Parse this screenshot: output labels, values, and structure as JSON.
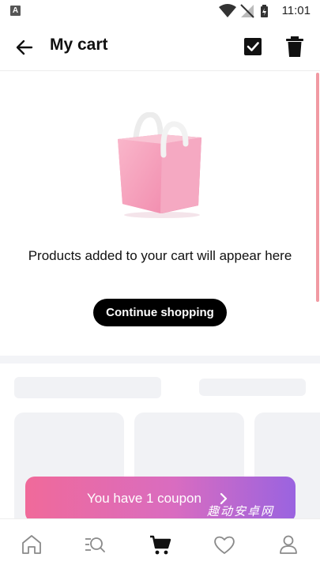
{
  "status_bar": {
    "time": "11:01",
    "icons": [
      "a-icon",
      "wifi-icon",
      "no-signal-icon",
      "battery-icon"
    ]
  },
  "header": {
    "title": "My cart",
    "icons": [
      "back-arrow-icon",
      "checkbox-checked-icon",
      "trash-icon"
    ]
  },
  "empty_state": {
    "message": "Products added to your cart will appear here",
    "button_label": "Continue shopping",
    "illustration": "shopping-bag-icon"
  },
  "coupon": {
    "label": "You have 1 coupon",
    "icon": "chevron-right-icon",
    "watermark": "趣动安卓网"
  },
  "bottom_nav": {
    "items": [
      "home-icon",
      "search-list-icon",
      "cart-icon",
      "heart-icon",
      "profile-icon"
    ],
    "active": "cart-icon"
  },
  "colors": {
    "accent": "#000000",
    "coupon_gradient_start": "#f06a9a",
    "coupon_gradient_end": "#9a63e0",
    "bag_pink": "#f7a9c0",
    "scrollbar": "#f19aa3"
  }
}
